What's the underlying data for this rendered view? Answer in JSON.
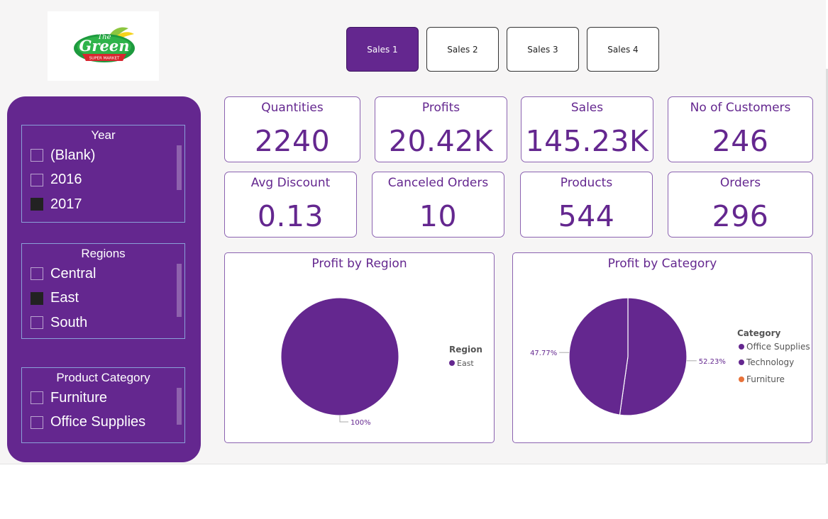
{
  "logo": {
    "line1": "The",
    "line2": "Green",
    "line3": "SUPER MARKET"
  },
  "nav": {
    "buttons": [
      "Sales 1",
      "Sales 2",
      "Sales 3",
      "Sales 4"
    ],
    "active": "Sales 1"
  },
  "slicers": {
    "year": {
      "title": "Year",
      "items": [
        {
          "label": "(Blank)",
          "checked": false
        },
        {
          "label": "2016",
          "checked": false
        },
        {
          "label": "2017",
          "checked": true
        }
      ]
    },
    "regions": {
      "title": "Regions",
      "items": [
        {
          "label": "Central",
          "checked": false
        },
        {
          "label": "East",
          "checked": true
        },
        {
          "label": "South",
          "checked": false
        }
      ]
    },
    "category": {
      "title": "Product Category",
      "items": [
        {
          "label": "Furniture",
          "checked": false
        },
        {
          "label": "Office Supplies",
          "checked": false
        }
      ]
    }
  },
  "kpis": [
    {
      "label": "Quantities",
      "value": "2240"
    },
    {
      "label": "Profits",
      "value": "20.42K"
    },
    {
      "label": "Sales",
      "value": "145.23K"
    },
    {
      "label": "No of Customers",
      "value": "246"
    },
    {
      "label": "Avg Discount",
      "value": "0.13"
    },
    {
      "label": "Canceled Orders",
      "value": "10"
    },
    {
      "label": "Products",
      "value": "544"
    },
    {
      "label": "Orders",
      "value": "296"
    }
  ],
  "colors": {
    "primary": "#64278f",
    "orange": "#e8723a"
  },
  "chart_data": [
    {
      "type": "pie",
      "title": "Profit by Region",
      "legend_title": "Region",
      "legend_position": "right",
      "slices": [
        {
          "name": "East",
          "value": 100,
          "label": "100%",
          "color": "#64278f"
        }
      ]
    },
    {
      "type": "pie",
      "title": "Profit by Category",
      "legend_title": "Category",
      "legend_position": "right",
      "slices": [
        {
          "name": "Office Supplies",
          "value": 52.23,
          "label": "52.23%",
          "color": "#64278f"
        },
        {
          "name": "Technology",
          "value": 47.77,
          "label": "47.77%",
          "color": "#64278f"
        }
      ],
      "legend": [
        {
          "name": "Office Supplies",
          "color": "#64278f"
        },
        {
          "name": "Technology",
          "color": "#64278f"
        },
        {
          "name": "Furniture",
          "color": "#e8723a"
        }
      ]
    }
  ]
}
